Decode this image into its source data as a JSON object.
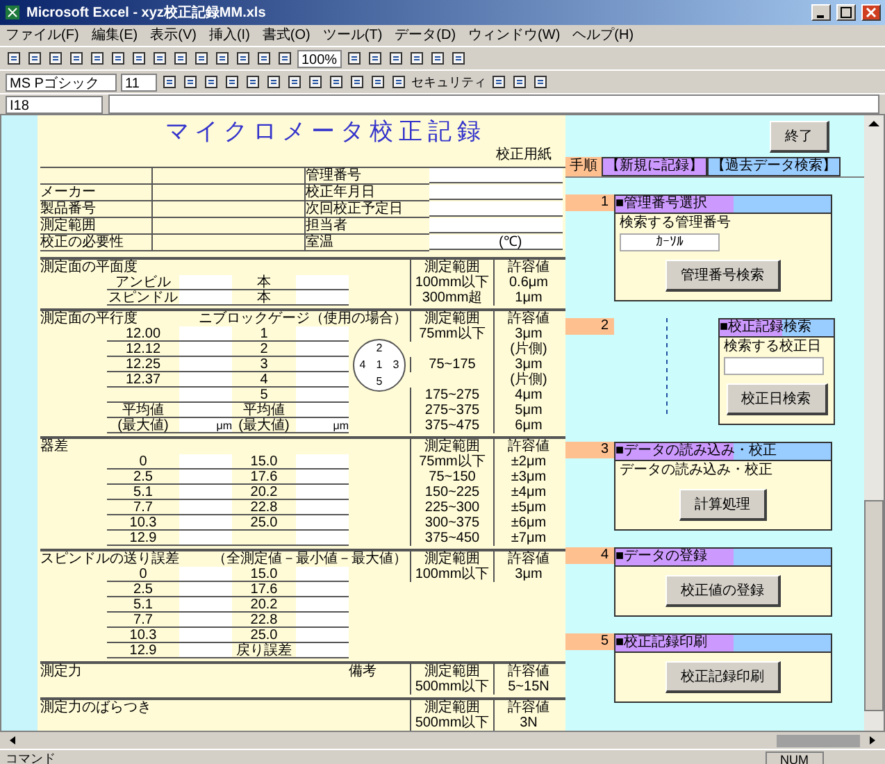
{
  "window": {
    "title": "Microsoft Excel - xyz校正記録MM.xls"
  },
  "menu": [
    "ファイル(F)",
    "編集(E)",
    "表示(V)",
    "挿入(I)",
    "書式(O)",
    "ツール(T)",
    "データ(D)",
    "ウィンドウ(W)",
    "ヘルプ(H)"
  ],
  "toolbar": {
    "zoom": "100%",
    "font": "MS Pゴシック",
    "size": "11",
    "security": "セキュリティ"
  },
  "formula_bar": {
    "name_box": "I18"
  },
  "sheet": {
    "title": "マイクロメータ校正記録",
    "subtitle": "校正用紙",
    "info": [
      {
        "right": "管理番号"
      },
      {
        "left": "メーカー",
        "right": "校正年月日"
      },
      {
        "left": "製品番号",
        "right": "次回校正予定日"
      },
      {
        "left": "測定範囲",
        "right": "担当者"
      },
      {
        "left": "校正の必要性",
        "right": "室温",
        "unit": "(℃)"
      }
    ],
    "sections": [
      {
        "title": "測定面の平面度",
        "spec_head": [
          "測定範囲",
          "許容値"
        ],
        "rows": [
          {
            "a": "アンビル",
            "b": "本",
            "range": "100mm以下",
            "tol": "0.6μm"
          },
          {
            "a": "スピンドル",
            "b": "本",
            "range": "300mm超",
            "tol": "1μm"
          }
        ]
      },
      {
        "title": "測定面の平行度",
        "note": "ニブロックゲージ（使用の場合）",
        "spec_head": [
          "測定範囲",
          "許容値"
        ],
        "figure": [
          "2",
          "4",
          "1",
          "3",
          "5"
        ],
        "rows": [
          {
            "a": "12.00",
            "b": "1",
            "range": "75mm以下",
            "tol": "3μm"
          },
          {
            "a": "12.12",
            "b": "2",
            "tol": "(片側)"
          },
          {
            "a": "12.25",
            "b": "3",
            "range": "75~175",
            "tol": "3μm"
          },
          {
            "a": "12.37",
            "b": "4",
            "tol": "(片側)"
          },
          {
            "b": "5",
            "range": "175~275",
            "tol": "4μm"
          },
          {
            "a": "平均値",
            "b": "平均値",
            "range": "275~375",
            "tol": "5μm"
          },
          {
            "a": "(最大値)",
            "b": "(最大値)",
            "ua": "μm",
            "ub": "μm",
            "range": "375~475",
            "tol": "6μm"
          }
        ]
      },
      {
        "title": "器差",
        "spec_head": [
          "測定範囲",
          "許容値"
        ],
        "rows": [
          {
            "a": "0",
            "b": "15.0",
            "range": "75mm以下",
            "tol": "±2μm"
          },
          {
            "a": "2.5",
            "b": "17.6",
            "range": "75~150",
            "tol": "±3μm"
          },
          {
            "a": "5.1",
            "b": "20.2",
            "range": "150~225",
            "tol": "±4μm"
          },
          {
            "a": "7.7",
            "b": "22.8",
            "range": "225~300",
            "tol": "±5μm"
          },
          {
            "a": "10.3",
            "b": "25.0",
            "range": "300~375",
            "tol": "±6μm"
          },
          {
            "a": "12.9",
            "range": "375~450",
            "tol": "±7μm"
          }
        ]
      },
      {
        "title": "スピンドルの送り誤差",
        "note": "（全測定値－最小値－最大値）",
        "spec_head": [
          "測定範囲",
          "許容値"
        ],
        "rows": [
          {
            "a": "0",
            "b": "15.0",
            "range": "100mm以下",
            "tol": "3μm"
          },
          {
            "a": "2.5",
            "b": "17.6"
          },
          {
            "a": "5.1",
            "b": "20.2"
          },
          {
            "a": "7.7",
            "b": "22.8"
          },
          {
            "a": "10.3",
            "b": "25.0"
          },
          {
            "a": "12.9",
            "b": "戻り誤差"
          }
        ]
      },
      {
        "title": "測定力",
        "spec_head": [
          "測定範囲",
          "許容値"
        ],
        "remark": "備考",
        "rows": [
          {
            "range": "500mm以下",
            "tol": "5~15N"
          }
        ]
      },
      {
        "title": "測定力のばらつき",
        "spec_head": [
          "測定範囲",
          "許容値"
        ],
        "rows": [
          {
            "range": "500mm以下",
            "tol": "3N"
          }
        ]
      }
    ]
  },
  "panel": {
    "end_button": "終了",
    "steps_label": "手順",
    "tabs": [
      {
        "label": "【新規に記録】",
        "selected": true
      },
      {
        "label": "【過去データ検索】",
        "selected": false
      }
    ],
    "steps": [
      {
        "number": "1",
        "kind": "wide",
        "title": "■管理番号選択",
        "label": "検索する管理番号",
        "search_field": true,
        "field": "ｶｰｿﾙ",
        "button": "管理番号検索"
      },
      {
        "number": "2",
        "kind": "narrow",
        "title": "■校正記録検索",
        "label": "検索する校正日",
        "search_field": true,
        "button": "校正日検索"
      },
      {
        "number": "3",
        "kind": "wide",
        "title": "■データの読み込み・校正",
        "label": "データの読み込み・校正",
        "button": "計算処理"
      },
      {
        "number": "4",
        "kind": "wide",
        "title": "■データの登録",
        "button": "校正値の登録"
      },
      {
        "number": "5",
        "kind": "wide",
        "title": "■校正記録印刷",
        "button": "校正記録印刷"
      }
    ]
  },
  "status_bar": {
    "mode": "コマンド",
    "num": "NUM"
  }
}
